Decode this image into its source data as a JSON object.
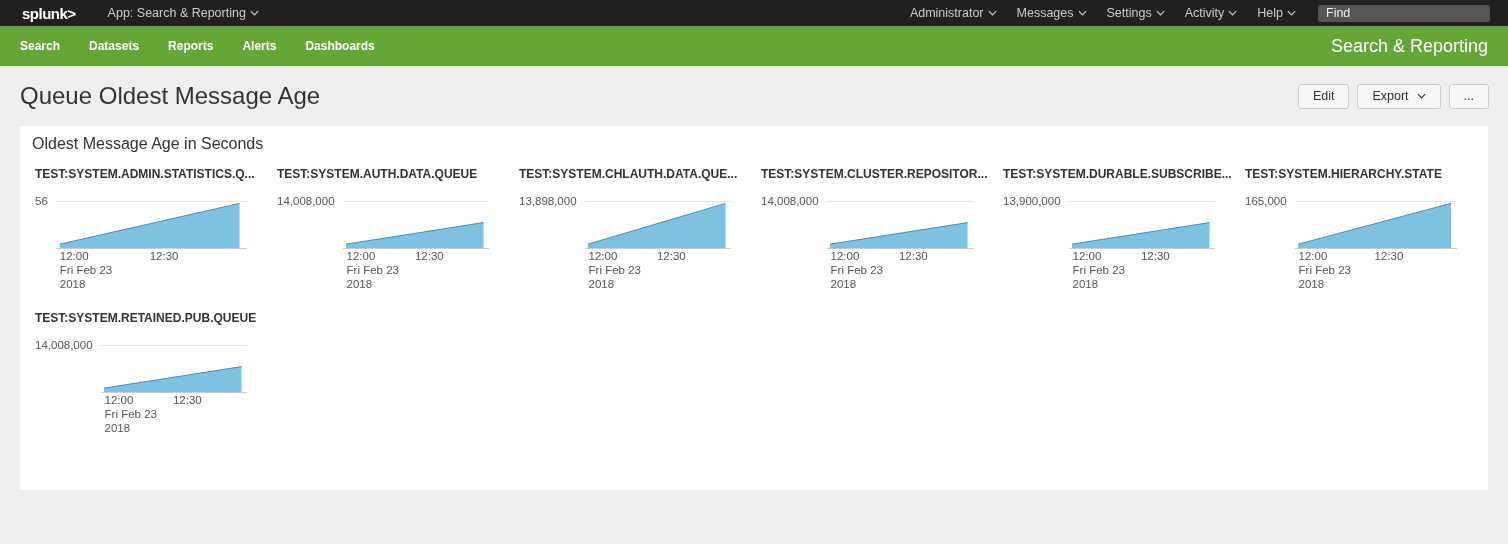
{
  "top_bar": {
    "logo": "splunk>",
    "app_menu": "App: Search & Reporting",
    "menus": [
      "Administrator",
      "Messages",
      "Settings",
      "Activity",
      "Help"
    ],
    "search": {
      "placeholder": "Find"
    }
  },
  "app_bar": {
    "nav": [
      "Search",
      "Datasets",
      "Reports",
      "Alerts",
      "Dashboards"
    ],
    "app_title": "Search & Reporting"
  },
  "page": {
    "title": "Queue Oldest Message Age",
    "buttons": [
      {
        "label": "Edit",
        "kind": "plain"
      },
      {
        "label": "Export",
        "kind": "dropdown"
      },
      {
        "label": "...",
        "kind": "plain"
      }
    ]
  },
  "panel": {
    "title": "Oldest Message Age in Seconds",
    "charts": [
      {
        "title": "TEST:SYSTEM.ADMIN.STATISTICS.Q...",
        "y_tick": "56",
        "x_ticks": [
          "12:00",
          "12:30"
        ],
        "date": [
          "Fri Feb 23",
          "2018"
        ]
      },
      {
        "title": "TEST:SYSTEM.AUTH.DATA.QUEUE",
        "y_tick": "14,008,000",
        "x_ticks": [
          "12:00",
          "12:30"
        ],
        "date": [
          "Fri Feb 23",
          "2018"
        ]
      },
      {
        "title": "TEST:SYSTEM.CHLAUTH.DATA.QUE...",
        "y_tick": "13,898,000",
        "x_ticks": [
          "12:00",
          "12:30"
        ],
        "date": [
          "Fri Feb 23",
          "2018"
        ]
      },
      {
        "title": "TEST:SYSTEM.CLUSTER.REPOSITOR...",
        "y_tick": "14,008,000",
        "x_ticks": [
          "12:00",
          "12:30"
        ],
        "date": [
          "Fri Feb 23",
          "2018"
        ]
      },
      {
        "title": "TEST:SYSTEM.DURABLE.SUBSCRIBE...",
        "y_tick": "13,900,000",
        "x_ticks": [
          "12:00",
          "12:30"
        ],
        "date": [
          "Fri Feb 23",
          "2018"
        ]
      },
      {
        "title": "TEST:SYSTEM.HIERARCHY.STATE",
        "y_tick": "165,000",
        "x_ticks": [
          "12:00",
          "12:30"
        ],
        "date": [
          "Fri Feb 23",
          "2018"
        ]
      },
      {
        "title": "TEST:SYSTEM.RETAINED.PUB.QUEUE",
        "y_tick": "14,008,000",
        "x_ticks": [
          "12:00",
          "12:30"
        ],
        "date": [
          "Fri Feb 23",
          "2018"
        ]
      }
    ]
  }
}
